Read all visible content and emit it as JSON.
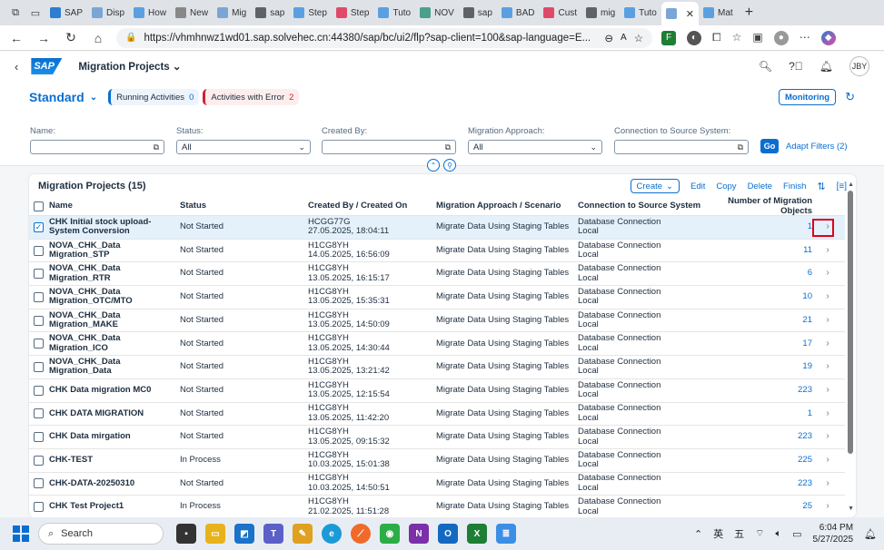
{
  "browser": {
    "tabs": [
      {
        "label": "SAP",
        "color": "#2d7dd2"
      },
      {
        "label": "Disp",
        "color": "#7aa6d6"
      },
      {
        "label": "How",
        "color": "#5aa0e0"
      },
      {
        "label": "New",
        "color": "#888888"
      },
      {
        "label": "Mig",
        "color": "#7aa6d6"
      },
      {
        "label": "sap",
        "color": "#5f6368"
      },
      {
        "label": "Step",
        "color": "#5aa0e0"
      },
      {
        "label": "Step",
        "color": "#e04a6a"
      },
      {
        "label": "Tuto",
        "color": "#5aa0e0"
      },
      {
        "label": "NOV",
        "color": "#4aa08a"
      },
      {
        "label": "sap",
        "color": "#5f6368"
      },
      {
        "label": "BAD",
        "color": "#5aa0e0"
      },
      {
        "label": "Cust",
        "color": "#e04a6a"
      },
      {
        "label": "mig",
        "color": "#5f6368"
      },
      {
        "label": "Tuto",
        "color": "#5aa0e0"
      },
      {
        "label": "",
        "color": "#7aa6d6",
        "active": true
      },
      {
        "label": "Mat",
        "color": "#5aa0e0"
      }
    ],
    "url": "https://vhmhnwz1wd01.sap.solvehec.cn:44380/sap/bc/ui2/flp?sap-client=100&sap-language=E..."
  },
  "shell": {
    "app_title": "Migration Projects",
    "avatar": "JBY"
  },
  "header": {
    "variant": "Standard",
    "running_label": "Running Activities",
    "running_count": "0",
    "error_label": "Activities with Error",
    "error_count": "2",
    "monitoring": "Monitoring"
  },
  "filters": {
    "name_label": "Name:",
    "status_label": "Status:",
    "status_value": "All",
    "created_label": "Created By:",
    "approach_label": "Migration Approach:",
    "approach_value": "All",
    "conn_label": "Connection to Source System:",
    "go": "Go",
    "adapt": "Adapt Filters (2)"
  },
  "table": {
    "title": "Migration Projects (15)",
    "toolbar": {
      "create": "Create",
      "edit": "Edit",
      "copy": "Copy",
      "delete": "Delete",
      "finish": "Finish"
    },
    "columns": [
      "Name",
      "Status",
      "Created By / Created On",
      "Migration Approach / Scenario",
      "Connection to Source System",
      "Number of Migration Objects"
    ],
    "rows": [
      {
        "name": "CHK Initial stock upload-System Conversion",
        "status": "Not Started",
        "by": "HCGG77G",
        "on": "27.05.2025, 18:04:11",
        "approach": "Migrate Data Using Staging Tables",
        "conn1": "Database Connection",
        "conn2": "Local",
        "count": "1",
        "selected": true
      },
      {
        "name": "NOVA_CHK_Data Migration_STP",
        "status": "Not Started",
        "by": "H1CG8YH",
        "on": "14.05.2025, 16:56:09",
        "approach": "Migrate Data Using Staging Tables",
        "conn1": "Database Connection",
        "conn2": "Local",
        "count": "11"
      },
      {
        "name": "NOVA_CHK_Data Migration_RTR",
        "status": "Not Started",
        "by": "H1CG8YH",
        "on": "13.05.2025, 16:15:17",
        "approach": "Migrate Data Using Staging Tables",
        "conn1": "Database Connection",
        "conn2": "Local",
        "count": "6"
      },
      {
        "name": "NOVA_CHK_Data Migration_OTC/MTO",
        "status": "Not Started",
        "by": "H1CG8YH",
        "on": "13.05.2025, 15:35:31",
        "approach": "Migrate Data Using Staging Tables",
        "conn1": "Database Connection",
        "conn2": "Local",
        "count": "10"
      },
      {
        "name": "NOVA_CHK_Data Migration_MAKE",
        "status": "Not Started",
        "by": "H1CG8YH",
        "on": "13.05.2025, 14:50:09",
        "approach": "Migrate Data Using Staging Tables",
        "conn1": "Database Connection",
        "conn2": "Local",
        "count": "21"
      },
      {
        "name": "NOVA_CHK_Data Migration_ICO",
        "status": "Not Started",
        "by": "H1CG8YH",
        "on": "13.05.2025, 14:30:44",
        "approach": "Migrate Data Using Staging Tables",
        "conn1": "Database Connection",
        "conn2": "Local",
        "count": "17"
      },
      {
        "name": "NOVA_CHK_Data Migration_Data",
        "status": "Not Started",
        "by": "H1CG8YH",
        "on": "13.05.2025, 13:21:42",
        "approach": "Migrate Data Using Staging Tables",
        "conn1": "Database Connection",
        "conn2": "Local",
        "count": "19"
      },
      {
        "name": "CHK Data migration MC0",
        "status": "Not Started",
        "by": "H1CG8YH",
        "on": "13.05.2025, 12:15:54",
        "approach": "Migrate Data Using Staging Tables",
        "conn1": "Database Connection",
        "conn2": "Local",
        "count": "223"
      },
      {
        "name": "CHK DATA MIGRATION",
        "status": "Not Started",
        "by": "H1CG8YH",
        "on": "13.05.2025, 11:42:20",
        "approach": "Migrate Data Using Staging Tables",
        "conn1": "Database Connection",
        "conn2": "Local",
        "count": "1"
      },
      {
        "name": "CHK Data mirgation",
        "status": "Not Started",
        "by": "H1CG8YH",
        "on": "13.05.2025, 09:15:32",
        "approach": "Migrate Data Using Staging Tables",
        "conn1": "Database Connection",
        "conn2": "Local",
        "count": "223"
      },
      {
        "name": "CHK-TEST",
        "status": "In Process",
        "by": "H1CG8YH",
        "on": "10.03.2025, 15:01:38",
        "approach": "Migrate Data Using Staging Tables",
        "conn1": "Database Connection",
        "conn2": "Local",
        "count": "225"
      },
      {
        "name": "CHK-DATA-20250310",
        "status": "Not Started",
        "by": "H1CG8YH",
        "on": "10.03.2025, 14:50:51",
        "approach": "Migrate Data Using Staging Tables",
        "conn1": "Database Connection",
        "conn2": "Local",
        "count": "223"
      },
      {
        "name": "CHK Test Project1",
        "status": "In Process",
        "by": "H1CG8YH",
        "on": "21.02.2025, 11:51:28",
        "approach": "Migrate Data Using Staging Tables",
        "conn1": "Database Connection",
        "conn2": "Local",
        "count": "25"
      }
    ]
  },
  "taskbar": {
    "search": "Search",
    "ime1": "英",
    "ime2": "五",
    "time": "6:04 PM",
    "date": "5/27/2025"
  }
}
